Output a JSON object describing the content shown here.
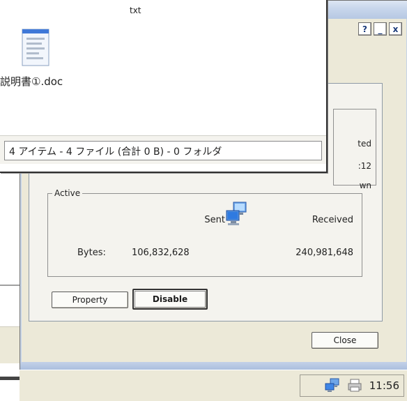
{
  "explorer": {
    "ext_label": "txt",
    "file_name": "説明書①.doc",
    "status_text": "4 アイテム - 4 ファイル (合計 0 B) - 0 フォルダ"
  },
  "dialog": {
    "buttons": {
      "help": "?",
      "minimize": "_",
      "close": "x"
    },
    "connection": {
      "status_fragment": "ted",
      "duration_fragment": ":12",
      "speed_fragment": "wn"
    },
    "activity": {
      "legend": "Active",
      "sent_label": "Sent",
      "received_label": "Received",
      "bytes_label": "Bytes:",
      "bytes_sent": "106,832,628",
      "bytes_received": "240,981,648"
    },
    "property_label": "Property",
    "disable_label": "Disable",
    "close_label": "Close"
  },
  "taskbar": {
    "clock": "11:56",
    "tray_icons": [
      "network-icon",
      "printer-icon"
    ]
  },
  "colors": {
    "dialog_bg": "#ece9d8",
    "titlebar": "#c9d7ec",
    "accent_blue": "#1a3a7a"
  }
}
